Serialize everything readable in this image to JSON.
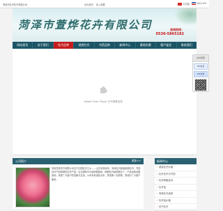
{
  "topbar": {
    "left_text": "菏泽市牡丹花卉有限公司",
    "links": [
      "设为首页",
      "加入收藏"
    ],
    "lang_cn": "中文版",
    "lang_en": "ENGLISH"
  },
  "header": {
    "logo_text": "菏泽市萱烨花卉有限公司",
    "hotline_label": "咨询热线：",
    "hotline": "0530-5865182"
  },
  "nav": {
    "items": [
      {
        "label": "网站首页"
      },
      {
        "label": "关于我们"
      },
      {
        "label": "牡丹品种"
      },
      {
        "label": "观赏牡丹"
      },
      {
        "label": "芍药品种"
      },
      {
        "label": "新闻中心"
      },
      {
        "label": "基地实景"
      },
      {
        "label": "客户留言"
      },
      {
        "label": "联系我们"
      }
    ],
    "active_index": 2
  },
  "banner": {
    "plugin_text": "Adobe Flash Player 已不再受支持"
  },
  "float_panel": {
    "title": "在线客服",
    "buttons": [
      "QQ交谈",
      "QQ交谈",
      "QQ交谈"
    ]
  },
  "intro": {
    "title": "公司简介",
    "more": "更多>>",
    "text": "菏泽萱烨花卉有限公司位于中国牡丹之乡——山东省菏泽市。菏泽牡丹营销各种牡丹，芍药牡丹产品和销售牡丹产品，企业拥有500亩种植基地，种植牡丹品种数百个。产品远销全国各地，深受广大客户的信赖与支持。公司本着诚信为本，质量第一的原则，竭诚为广大客户服务。"
  },
  "sidebar": {
    "title": "新闻中心",
    "items": [
      "观赏牡丹价格",
      "牡丹花卉与芍药",
      "牡丹种植技术",
      "牡丹苗",
      "菏泽牡丹品种",
      "牡丹苗价格",
      "关于牡丹"
    ]
  },
  "colors": {
    "nav_bg": "#1b5566",
    "nav_active": "#c51d1d",
    "hotline": "#c81414"
  }
}
